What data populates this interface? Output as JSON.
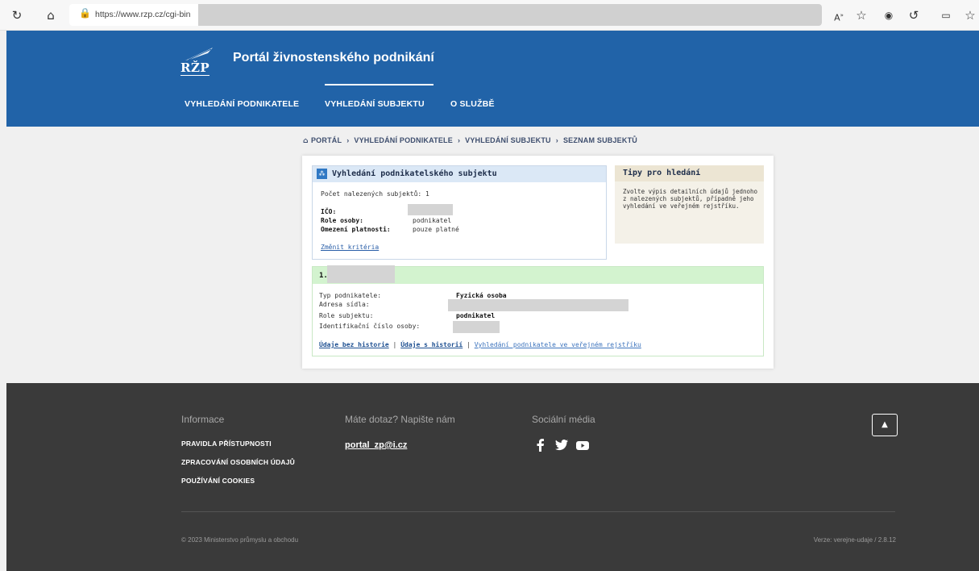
{
  "browser": {
    "url": "https://www.rzp.cz/cgi-bin",
    "icons": [
      "refresh-icon",
      "home-icon",
      "lock-icon",
      "read-aloud-icon",
      "favorite-icon",
      "extension-icon",
      "extension-icon",
      "split-screen-icon",
      "favorites-icon"
    ]
  },
  "header": {
    "logo_text": "RŽP",
    "title": "Portál živnostenského podnikání",
    "nav": [
      {
        "label": "VYHLEDÁNÍ PODNIKATELE"
      },
      {
        "label": "VYHLEDÁNÍ SUBJEKTU",
        "active": true
      },
      {
        "label": "O SLUŽBĚ"
      }
    ],
    "colors": {
      "header_bg": "#2163a8"
    }
  },
  "breadcrumb": {
    "items": [
      "PORTÁL",
      "VYHLEDÁNÍ PODNIKATELE",
      "VYHLEDÁNÍ SUBJEKTU",
      "SEZNAM SUBJEKTŮ"
    ]
  },
  "search_panel": {
    "title": "Vyhledání podnikatelského subjektu",
    "count_text": "Počet nalezených subjektů: 1",
    "fields": [
      {
        "label": "IČO:",
        "value": ""
      },
      {
        "label": "Role osoby:",
        "value": "podnikatel"
      },
      {
        "label": "Omezení platnosti:",
        "value": "pouze platné"
      }
    ],
    "change_link": "Změnit kritéria"
  },
  "tips": {
    "title": "Tipy pro hledání",
    "text": "Zvolte výpis detailních údajů jednoho z nalezených subjektů, případně jeho vyhledání ve veřejném rejstříku."
  },
  "result": {
    "number": "1.",
    "rows": [
      {
        "label": "Typ podnikatele:",
        "value": "Fyzická osoba"
      },
      {
        "label": "Adresa sídla:",
        "value": ""
      },
      {
        "label": "Role subjektu:",
        "value": "podnikatel"
      },
      {
        "label": "Identifikační číslo osoby:",
        "value": ""
      }
    ],
    "links": {
      "without_history": "Údaje bez historie",
      "with_history": "Údaje s historií",
      "public_register": "Vyhledání podnikatele ve veřejném rejstříku",
      "separator": "|"
    }
  },
  "footer": {
    "info_heading": "Informace",
    "info_links": [
      "PRAVIDLA PŘÍSTUPNOSTI",
      "ZPRACOVÁNÍ OSOBNÍCH ÚDAJŮ",
      "POUŽÍVÁNÍ COOKIES"
    ],
    "contact_heading": "Máte dotaz? Napište nám",
    "contact_email": "portal_zp@i.cz",
    "social_heading": "Sociální média",
    "social_icons": [
      "facebook-icon",
      "twitter-icon",
      "youtube-icon"
    ],
    "copyright": "© 2023 Ministerstvo průmyslu a obchodu",
    "version": "Verze: verejne-udaje / 2.8.12",
    "to_top_icon": "chevron-up-icon"
  }
}
